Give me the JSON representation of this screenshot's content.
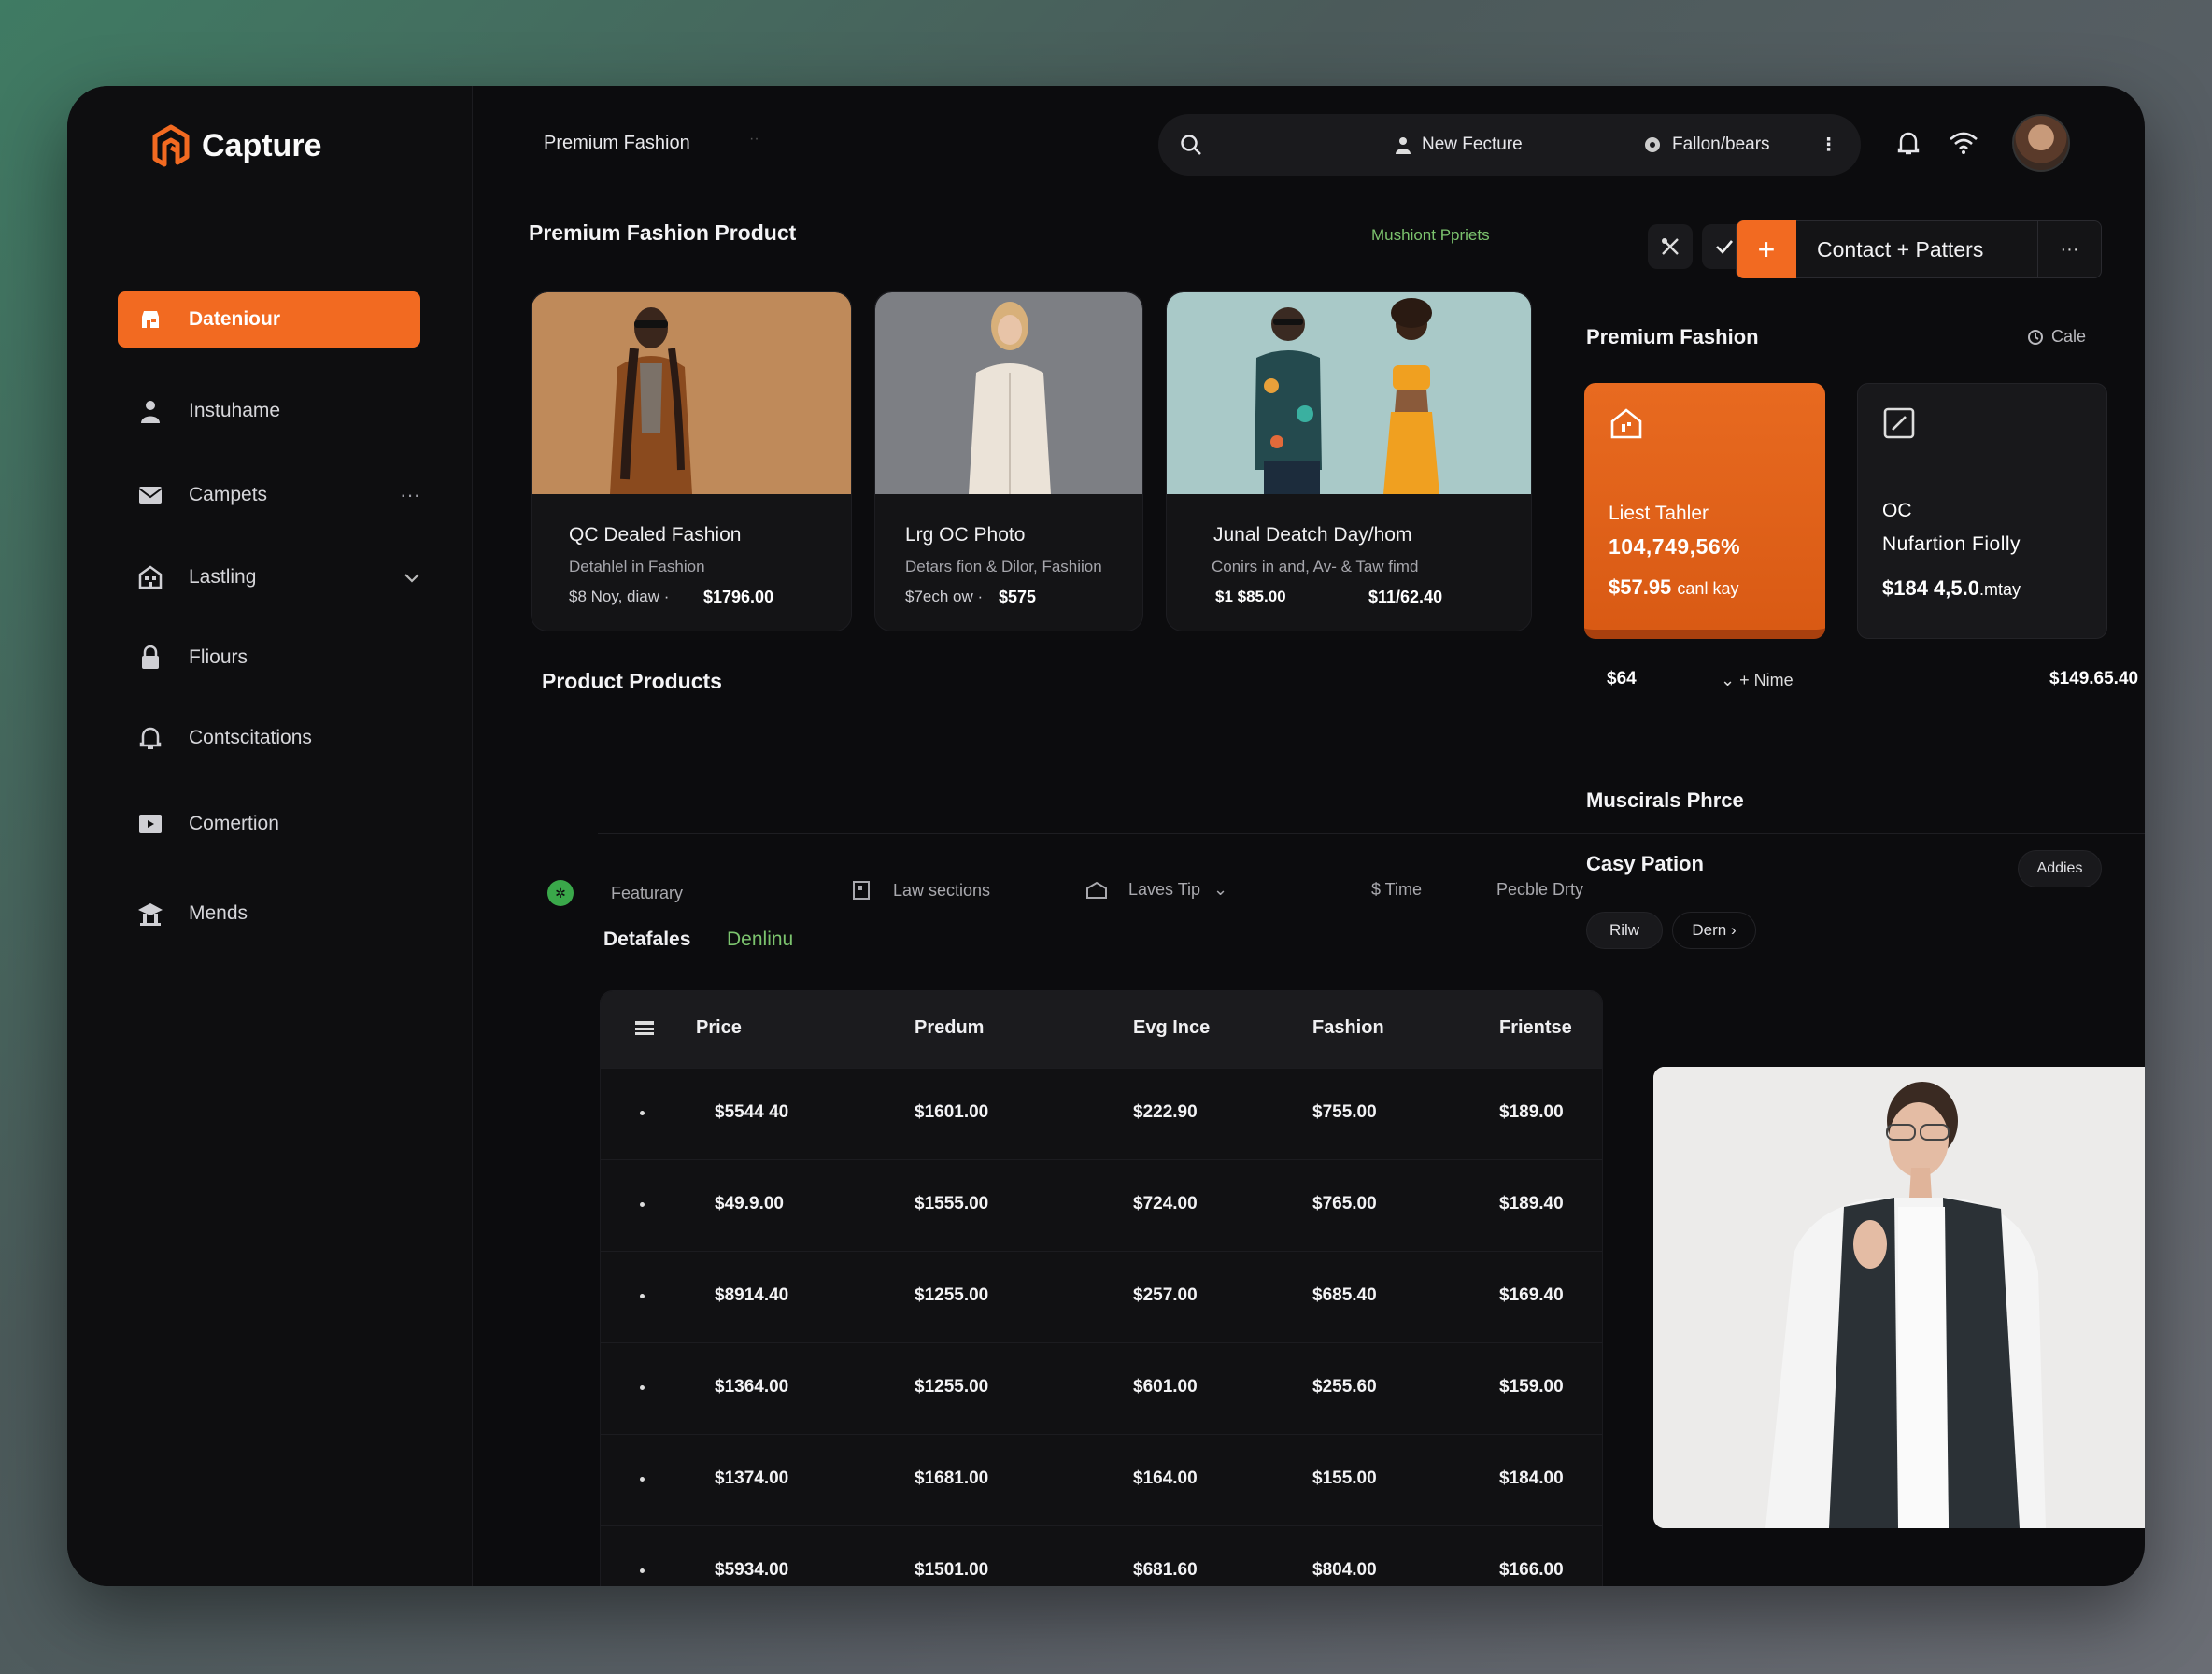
{
  "app": {
    "name": "Capture"
  },
  "sidebar": {
    "items": [
      {
        "label": "Dateniour",
        "icon": "store-icon",
        "active": true
      },
      {
        "label": "Instuhame",
        "icon": "user-icon"
      },
      {
        "label": "Campets",
        "icon": "mail-icon",
        "trail": "···"
      },
      {
        "label": "Lastling",
        "icon": "building-icon",
        "trail": "chevron-down-icon"
      },
      {
        "label": "Fliours",
        "icon": "lock-icon"
      },
      {
        "label": "Contscitations",
        "icon": "bell-icon"
      },
      {
        "label": "Comertion",
        "icon": "media-icon"
      },
      {
        "label": "Mends",
        "icon": "school-icon"
      }
    ]
  },
  "topbar": {
    "title": "Premium Fashion",
    "search_pill_1": "New Fecture",
    "search_pill_2": "Fallon/bears"
  },
  "products": {
    "heading": "Premium Fashion Product",
    "link": "Mushiont Ppriets",
    "cards": [
      {
        "title": "QC Dealed Fashion",
        "sub": "Detahlel in Fashion",
        "meta": "$8 Noy, diaw ·",
        "price": "$1796.00"
      },
      {
        "title": "Lrg OC Photo",
        "sub": "Detars fion & Dilor, Fashiion",
        "meta": "$7ech ow ·",
        "price": "$575"
      },
      {
        "title": "Junal Deatch Day/hom",
        "sub": "Conirs in and, Av- & Taw fimd",
        "meta": "$1 $85.00",
        "price": "$11/62.40"
      }
    ]
  },
  "toolbar": {
    "contact_label": "Contact + Patters",
    "more": "···"
  },
  "premium": {
    "heading": "Premium Fashion",
    "cale": "Cale",
    "stat1": {
      "l1": "Liest Tahler",
      "l2": "104,749,56%",
      "l3": "$57.95",
      "l3_suffix": "canl kay"
    },
    "stat2": {
      "l1": "OC",
      "l2": "Nufartion Fiolly",
      "l3": "$184 4,5.0",
      "l3_suffix": ".mtay"
    },
    "footer_left": "$64",
    "footer_mid": "Nime",
    "footer_right": "$149.65.40"
  },
  "product_products": {
    "heading": "Product Products",
    "filters": [
      "Featurary",
      "Law sections",
      "Laves Tip",
      "$ Time",
      "Pecble Drty"
    ],
    "tabs": [
      "Detafales",
      "Denlinu"
    ]
  },
  "table": {
    "headers": [
      "Price",
      "Predum",
      "Evg Ince",
      "Fashion",
      "Frientse"
    ],
    "rows": [
      [
        "$5544 40",
        "$1601.00",
        "$222.90",
        "$755.00",
        "$189.00"
      ],
      [
        "$49.9.00",
        "$1555.00",
        "$724.00",
        "$765.00",
        "$189.40"
      ],
      [
        "$8914.40",
        "$1255.00",
        "$257.00",
        "$685.40",
        "$169.40"
      ],
      [
        "$1364.00",
        "$1255.00",
        "$601.00",
        "$255.60",
        "$159.00"
      ],
      [
        "$1374.00",
        "$1681.00",
        "$164.00",
        "$155.00",
        "$184.00"
      ],
      [
        "$5934.00",
        "$1501.00",
        "$681.60",
        "$804.00",
        "$166.00"
      ]
    ]
  },
  "right_lower": {
    "heading1": "Muscirals Phrce",
    "heading2": "Casy Pation",
    "addies": "Addies",
    "chip1": "Rilw",
    "chip2": "Dern"
  },
  "colors": {
    "accent": "#f26a21",
    "green": "#7cc36e",
    "bg": "#0c0c0e"
  }
}
